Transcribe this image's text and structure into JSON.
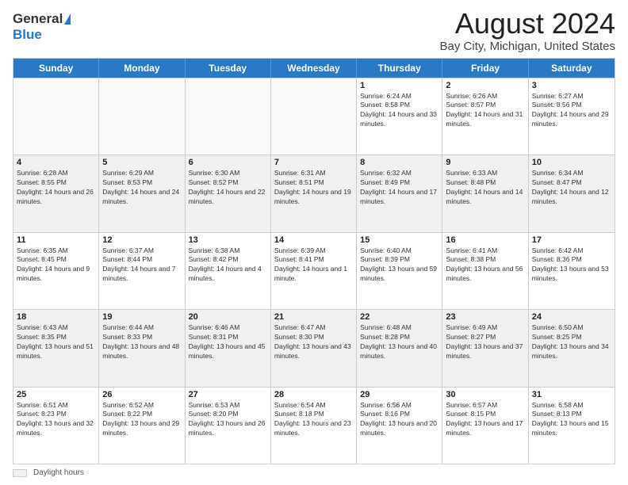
{
  "logo": {
    "general": "General",
    "blue": "Blue"
  },
  "title": "August 2024",
  "subtitle": "Bay City, Michigan, United States",
  "days_of_week": [
    "Sunday",
    "Monday",
    "Tuesday",
    "Wednesday",
    "Thursday",
    "Friday",
    "Saturday"
  ],
  "weeks": [
    [
      {
        "day": "",
        "info": ""
      },
      {
        "day": "",
        "info": ""
      },
      {
        "day": "",
        "info": ""
      },
      {
        "day": "",
        "info": ""
      },
      {
        "day": "1",
        "info": "Sunrise: 6:24 AM\nSunset: 8:58 PM\nDaylight: 14 hours and 33 minutes."
      },
      {
        "day": "2",
        "info": "Sunrise: 6:26 AM\nSunset: 8:57 PM\nDaylight: 14 hours and 31 minutes."
      },
      {
        "day": "3",
        "info": "Sunrise: 6:27 AM\nSunset: 8:56 PM\nDaylight: 14 hours and 29 minutes."
      }
    ],
    [
      {
        "day": "4",
        "info": "Sunrise: 6:28 AM\nSunset: 8:55 PM\nDaylight: 14 hours and 26 minutes."
      },
      {
        "day": "5",
        "info": "Sunrise: 6:29 AM\nSunset: 8:53 PM\nDaylight: 14 hours and 24 minutes."
      },
      {
        "day": "6",
        "info": "Sunrise: 6:30 AM\nSunset: 8:52 PM\nDaylight: 14 hours and 22 minutes."
      },
      {
        "day": "7",
        "info": "Sunrise: 6:31 AM\nSunset: 8:51 PM\nDaylight: 14 hours and 19 minutes."
      },
      {
        "day": "8",
        "info": "Sunrise: 6:32 AM\nSunset: 8:49 PM\nDaylight: 14 hours and 17 minutes."
      },
      {
        "day": "9",
        "info": "Sunrise: 6:33 AM\nSunset: 8:48 PM\nDaylight: 14 hours and 14 minutes."
      },
      {
        "day": "10",
        "info": "Sunrise: 6:34 AM\nSunset: 8:47 PM\nDaylight: 14 hours and 12 minutes."
      }
    ],
    [
      {
        "day": "11",
        "info": "Sunrise: 6:35 AM\nSunset: 8:45 PM\nDaylight: 14 hours and 9 minutes."
      },
      {
        "day": "12",
        "info": "Sunrise: 6:37 AM\nSunset: 8:44 PM\nDaylight: 14 hours and 7 minutes."
      },
      {
        "day": "13",
        "info": "Sunrise: 6:38 AM\nSunset: 8:42 PM\nDaylight: 14 hours and 4 minutes."
      },
      {
        "day": "14",
        "info": "Sunrise: 6:39 AM\nSunset: 8:41 PM\nDaylight: 14 hours and 1 minute."
      },
      {
        "day": "15",
        "info": "Sunrise: 6:40 AM\nSunset: 8:39 PM\nDaylight: 13 hours and 59 minutes."
      },
      {
        "day": "16",
        "info": "Sunrise: 6:41 AM\nSunset: 8:38 PM\nDaylight: 13 hours and 56 minutes."
      },
      {
        "day": "17",
        "info": "Sunrise: 6:42 AM\nSunset: 8:36 PM\nDaylight: 13 hours and 53 minutes."
      }
    ],
    [
      {
        "day": "18",
        "info": "Sunrise: 6:43 AM\nSunset: 8:35 PM\nDaylight: 13 hours and 51 minutes."
      },
      {
        "day": "19",
        "info": "Sunrise: 6:44 AM\nSunset: 8:33 PM\nDaylight: 13 hours and 48 minutes."
      },
      {
        "day": "20",
        "info": "Sunrise: 6:46 AM\nSunset: 8:31 PM\nDaylight: 13 hours and 45 minutes."
      },
      {
        "day": "21",
        "info": "Sunrise: 6:47 AM\nSunset: 8:30 PM\nDaylight: 13 hours and 43 minutes."
      },
      {
        "day": "22",
        "info": "Sunrise: 6:48 AM\nSunset: 8:28 PM\nDaylight: 13 hours and 40 minutes."
      },
      {
        "day": "23",
        "info": "Sunrise: 6:49 AM\nSunset: 8:27 PM\nDaylight: 13 hours and 37 minutes."
      },
      {
        "day": "24",
        "info": "Sunrise: 6:50 AM\nSunset: 8:25 PM\nDaylight: 13 hours and 34 minutes."
      }
    ],
    [
      {
        "day": "25",
        "info": "Sunrise: 6:51 AM\nSunset: 8:23 PM\nDaylight: 13 hours and 32 minutes."
      },
      {
        "day": "26",
        "info": "Sunrise: 6:52 AM\nSunset: 8:22 PM\nDaylight: 13 hours and 29 minutes."
      },
      {
        "day": "27",
        "info": "Sunrise: 6:53 AM\nSunset: 8:20 PM\nDaylight: 13 hours and 26 minutes."
      },
      {
        "day": "28",
        "info": "Sunrise: 6:54 AM\nSunset: 8:18 PM\nDaylight: 13 hours and 23 minutes."
      },
      {
        "day": "29",
        "info": "Sunrise: 6:56 AM\nSunset: 8:16 PM\nDaylight: 13 hours and 20 minutes."
      },
      {
        "day": "30",
        "info": "Sunrise: 6:57 AM\nSunset: 8:15 PM\nDaylight: 13 hours and 17 minutes."
      },
      {
        "day": "31",
        "info": "Sunrise: 6:58 AM\nSunset: 8:13 PM\nDaylight: 13 hours and 15 minutes."
      }
    ]
  ],
  "footer": {
    "daylight_label": "Daylight hours"
  }
}
